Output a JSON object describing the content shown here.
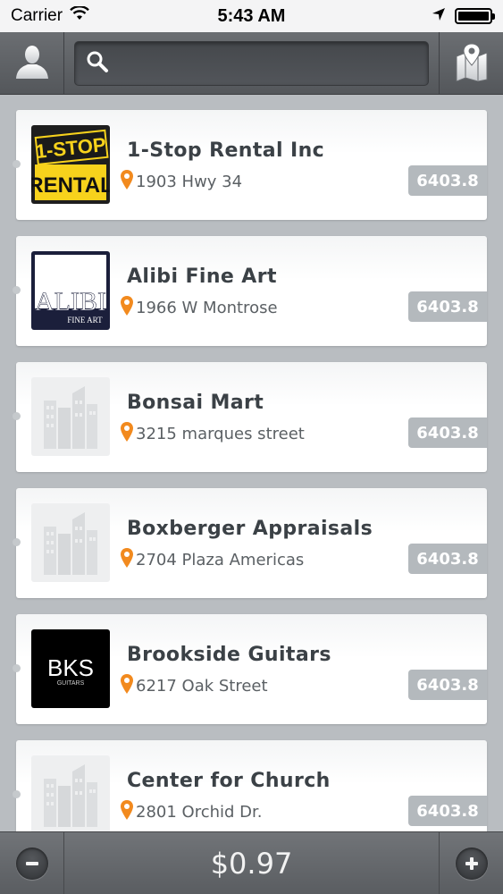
{
  "status_bar": {
    "carrier": "Carrier",
    "time": "5:43 AM"
  },
  "nav": {
    "search_placeholder": "",
    "left_icon": "user-icon",
    "right_icon": "map-icon"
  },
  "listings": [
    {
      "name": "1-Stop Rental Inc",
      "address": "1903 Hwy 34",
      "distance": "6403.8",
      "logo": "1-stop-rental-logo",
      "logo_lines": [
        "1-STOP",
        "RENTAL"
      ]
    },
    {
      "name": "Alibi Fine Art",
      "address": "1966 W Montrose",
      "distance": "6403.8",
      "logo": "alibi-logo",
      "logo_lines": [
        "ALIBI",
        "FINE ART"
      ]
    },
    {
      "name": "Bonsai Mart",
      "address": "3215 marques street",
      "distance": "6403.8",
      "logo": "building-placeholder-icon"
    },
    {
      "name": "Boxberger Appraisals",
      "address": "2704 Plaza Americas",
      "distance": "6403.8",
      "logo": "building-placeholder-icon"
    },
    {
      "name": "Brookside Guitars",
      "address": "6217 Oak Street",
      "distance": "6403.8",
      "logo": "bks-logo",
      "logo_lines": [
        "BKS",
        "GUITARS"
      ]
    },
    {
      "name": "Center for Church",
      "address": "2801 Orchid Dr.",
      "distance": "6403.8",
      "logo": "building-placeholder-icon"
    }
  ],
  "bottom": {
    "price": "$0.97",
    "minus_icon": "minus-icon",
    "plus_icon": "plus-icon"
  },
  "colors": {
    "pin": "#f28a1e",
    "badge": "#b4b9bd",
    "title": "#3b4146"
  }
}
